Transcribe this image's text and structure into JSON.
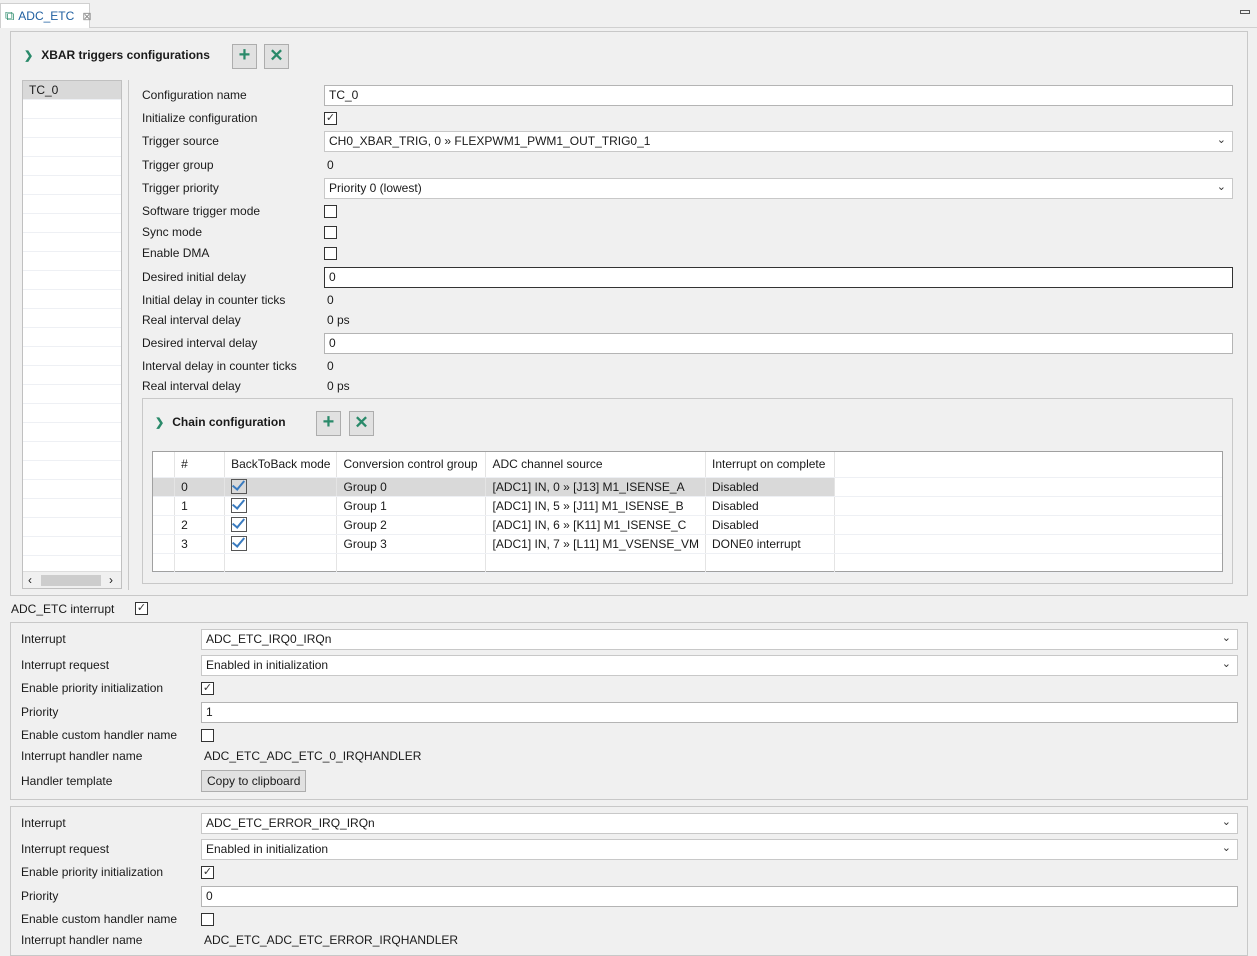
{
  "tab": {
    "title": "ADC_ETC",
    "icon": "component-puzzle-icon"
  },
  "xbar": {
    "title": "XBAR triggers configurations",
    "list": [
      "TC_0"
    ],
    "fields": [
      {
        "label": "Configuration name",
        "type": "input",
        "value": "TC_0"
      },
      {
        "label": "Initialize configuration",
        "type": "checkbox",
        "checked": true
      },
      {
        "label": "Trigger source",
        "type": "select",
        "value": "CH0_XBAR_TRIG, 0 » FLEXPWM1_PWM1_OUT_TRIG0_1"
      },
      {
        "label": "Trigger group",
        "type": "text",
        "value": "0"
      },
      {
        "label": "Trigger priority",
        "type": "select",
        "value": "Priority 0 (lowest)"
      },
      {
        "label": "Software trigger mode",
        "type": "checkbox",
        "checked": false
      },
      {
        "label": "Sync mode",
        "type": "checkbox",
        "checked": false
      },
      {
        "label": "Enable DMA",
        "type": "checkbox",
        "checked": false
      },
      {
        "label": "Desired initial delay",
        "type": "input",
        "value": "0",
        "focused": true
      },
      {
        "label": "Initial delay in counter ticks",
        "type": "text",
        "value": "0"
      },
      {
        "label": "Real interval delay",
        "type": "text",
        "value": "0 ps"
      },
      {
        "label": "Desired interval delay",
        "type": "input",
        "value": "0"
      },
      {
        "label": "Interval delay in counter ticks",
        "type": "text",
        "value": "0"
      },
      {
        "label": "Real interval delay",
        "type": "text",
        "value": "0 ps"
      }
    ]
  },
  "chain": {
    "title": "Chain configuration",
    "columns": [
      "#",
      "BackToBack mode",
      "Conversion control group",
      "ADC channel source",
      "Interrupt on complete"
    ],
    "rows": [
      {
        "index": "0",
        "backtoback": true,
        "group": "Group 0",
        "source": "[ADC1] IN, 0 » [J13] M1_ISENSE_A",
        "interrupt": "Disabled",
        "selected": true
      },
      {
        "index": "1",
        "backtoback": true,
        "group": "Group 1",
        "source": "[ADC1] IN, 5 » [J11] M1_ISENSE_B",
        "interrupt": "Disabled"
      },
      {
        "index": "2",
        "backtoback": true,
        "group": "Group 2",
        "source": "[ADC1] IN, 6 » [K11] M1_ISENSE_C",
        "interrupt": "Disabled"
      },
      {
        "index": "3",
        "backtoback": true,
        "group": "Group 3",
        "source": "[ADC1] IN, 7 » [L11] M1_VSENSE_VM",
        "interrupt": "DONE0 interrupt"
      }
    ]
  },
  "adc_etc_interrupt": {
    "label": "ADC_ETC interrupt",
    "checked": true
  },
  "interrupt_blocks": [
    {
      "fields": [
        {
          "label": "Interrupt",
          "type": "select",
          "value": "ADC_ETC_IRQ0_IRQn"
        },
        {
          "label": "Interrupt request",
          "type": "select",
          "value": "Enabled in initialization"
        },
        {
          "label": "Enable priority initialization",
          "type": "checkbox",
          "checked": true
        },
        {
          "label": "Priority",
          "type": "input",
          "value": "1"
        },
        {
          "label": "Enable custom handler name",
          "type": "checkbox",
          "checked": false
        },
        {
          "label": "Interrupt handler name",
          "type": "text",
          "value": "ADC_ETC_ADC_ETC_0_IRQHANDLER"
        },
        {
          "label": "Handler template",
          "type": "button",
          "value": "Copy to clipboard"
        }
      ]
    },
    {
      "fields": [
        {
          "label": "Interrupt",
          "type": "select",
          "value": "ADC_ETC_ERROR_IRQ_IRQn"
        },
        {
          "label": "Interrupt request",
          "type": "select",
          "value": "Enabled in initialization"
        },
        {
          "label": "Enable priority initialization",
          "type": "checkbox",
          "checked": true
        },
        {
          "label": "Priority",
          "type": "input",
          "value": "0"
        },
        {
          "label": "Enable custom handler name",
          "type": "checkbox",
          "checked": false
        },
        {
          "label": "Interrupt handler name",
          "type": "text",
          "value": "ADC_ETC_ADC_ETC_ERROR_IRQHANDLER"
        }
      ]
    }
  ],
  "colors": {
    "accent": "#2a8a6a",
    "selection": "#d9d9d9"
  }
}
